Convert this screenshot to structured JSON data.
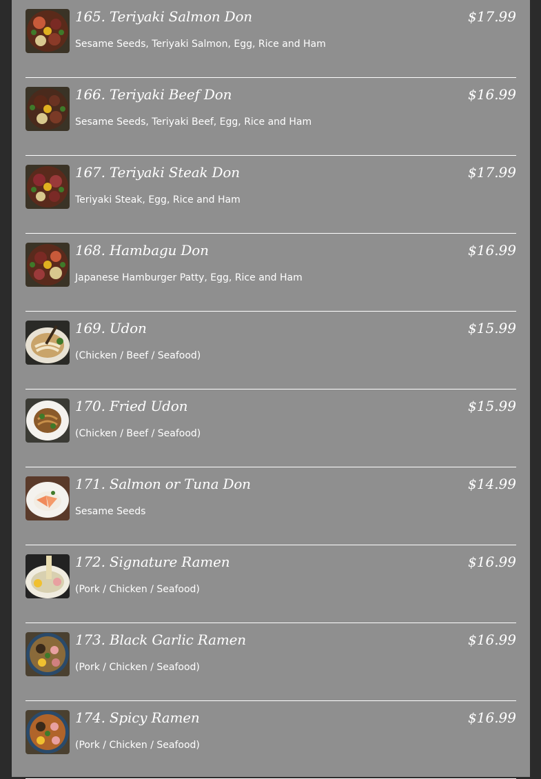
{
  "menu": {
    "items": [
      {
        "title": "165. Teriyaki Salmon Don",
        "price": "$17.99",
        "desc": "Sesame Seeds, Teriyaki Salmon, Egg, Rice and Ham",
        "image": "rice-bowl-photo"
      },
      {
        "title": "166. Teriyaki Beef Don",
        "price": "$16.99",
        "desc": "Sesame Seeds, Teriyaki Beef, Egg, Rice and Ham",
        "image": "rice-bowl-photo"
      },
      {
        "title": "167. Teriyaki Steak Don",
        "price": "$17.99",
        "desc": "Teriyaki Steak, Egg, Rice and Ham",
        "image": "rice-bowl-photo"
      },
      {
        "title": "168. Hambagu Don",
        "price": "$16.99",
        "desc": "Japanese Hamburger Patty, Egg, Rice and Ham",
        "image": "rice-bowl-photo"
      },
      {
        "title": "169. Udon",
        "price": "$15.99",
        "desc": "(Chicken / Beef / Seafood)",
        "image": "noodle-soup-photo"
      },
      {
        "title": "170. Fried Udon",
        "price": "$15.99",
        "desc": "(Chicken / Beef / Seafood)",
        "image": "fried-noodle-photo"
      },
      {
        "title": "171. Salmon or Tuna Don",
        "price": "$14.99",
        "desc": "Sesame Seeds",
        "image": "sashimi-plate-photo"
      },
      {
        "title": "172. Signature Ramen",
        "price": "$16.99",
        "desc": "(Pork / Chicken / Seafood)",
        "image": "ramen-photo"
      },
      {
        "title": "173. Black Garlic Ramen",
        "price": "$16.99",
        "desc": "(Pork / Chicken / Seafood)",
        "image": "ramen-photo"
      },
      {
        "title": "174. Spicy Ramen",
        "price": "$16.99",
        "desc": "(Pork / Chicken / Seafood)",
        "image": "ramen-photo"
      }
    ]
  },
  "colors": {
    "page_background": "#2b2b2b",
    "panel_background": "#8f8f8f",
    "text": "#ffffff",
    "divider": "#ffffff"
  }
}
